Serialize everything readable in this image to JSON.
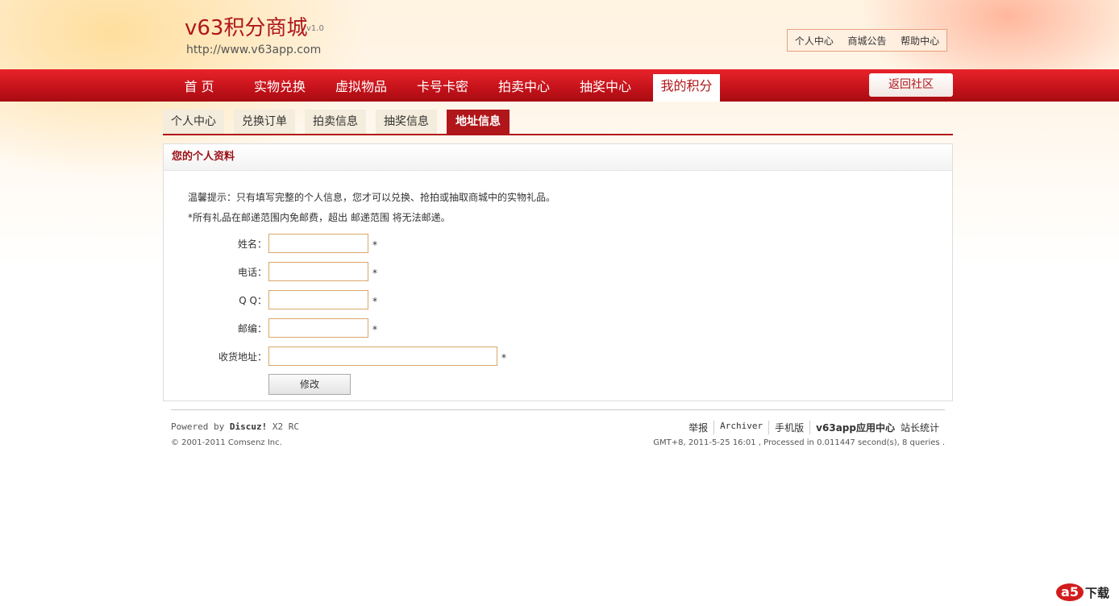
{
  "header": {
    "title": "v63积分商城",
    "version": "v1.0",
    "url": "http://www.v63app.com",
    "top_links": [
      "个人中心",
      "商城公告",
      "帮助中心"
    ]
  },
  "nav": {
    "items": [
      "首 页",
      "实物兑换",
      "虚拟物品",
      "卡号卡密",
      "拍卖中心",
      "抽奖中心",
      "我的积分"
    ],
    "active_index": 6,
    "back_button": "返回社区"
  },
  "subtabs": {
    "items": [
      "个人中心",
      "兑换订单",
      "拍卖信息",
      "抽奖信息",
      "地址信息"
    ],
    "active_index": 4
  },
  "panel": {
    "title": "您的个人资料",
    "tip1": "温馨提示：只有填写完整的个人信息，您才可以兑换、抢拍或抽取商城中的实物礼品。",
    "tip2": "*所有礼品在邮递范围内免邮费，超出 邮递范围 将无法邮递。",
    "fields": [
      {
        "label": "姓名：",
        "value": "",
        "required": "*"
      },
      {
        "label": "电话：",
        "value": "",
        "required": "*"
      },
      {
        "label": "Q Q：",
        "value": "",
        "required": "*"
      },
      {
        "label": "邮编：",
        "value": "",
        "required": "*"
      },
      {
        "label": "收货地址：",
        "value": "",
        "required": "*"
      }
    ],
    "submit_label": "修改"
  },
  "footer": {
    "powered_prefix": "Powered by",
    "powered_brand": "Discuz!",
    "powered_version": "X2 RC",
    "copyright": "© 2001-2011 Comsenz Inc.",
    "links": [
      "举报",
      "Archiver",
      "手机版",
      "v63app应用中心",
      "站长统计"
    ],
    "status": "GMT+8, 2011-5-25 16:01 , Processed in 0.011447 second(s), 8 queries ."
  },
  "watermark": {
    "badge": "a5",
    "text": "下载"
  },
  "colors": {
    "brand_red": "#b0161a",
    "nav_red": "#d01a20",
    "tab_bg": "#f4ecdc",
    "input_border": "#d8a76a"
  }
}
